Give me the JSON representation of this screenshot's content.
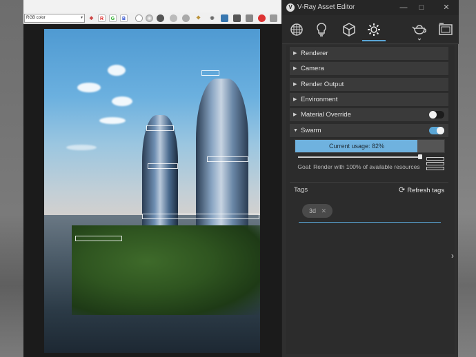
{
  "vfb": {
    "channel": "RGB color",
    "toolbar": {
      "r_label": "R",
      "g_label": "G",
      "b_label": "B"
    }
  },
  "editor": {
    "title": "V-Ray Asset Editor",
    "logo_glyph": "V",
    "window_controls": {
      "minimize": "—",
      "maximize": "□",
      "close": "✕"
    },
    "tabs": [
      {
        "name": "materials",
        "icon": "materials-sphere-icon"
      },
      {
        "name": "lights",
        "icon": "light-bulb-icon"
      },
      {
        "name": "geometry",
        "icon": "cube-icon"
      },
      {
        "name": "settings",
        "icon": "gear-icon",
        "active": true
      },
      {
        "name": "render",
        "icon": "teapot-icon"
      },
      {
        "name": "frame-buffer",
        "icon": "frame-buffer-icon"
      }
    ],
    "rollouts": [
      {
        "label": "Renderer",
        "expanded": false
      },
      {
        "label": "Camera",
        "expanded": false
      },
      {
        "label": "Render Output",
        "expanded": false
      },
      {
        "label": "Environment",
        "expanded": false
      },
      {
        "label": "Material Override",
        "expanded": false,
        "toggle": false
      },
      {
        "label": "Swarm",
        "expanded": true,
        "toggle": true
      }
    ],
    "swarm": {
      "usage_label": "Current usage: 82%",
      "usage_fraction": 0.82,
      "goal": "Goal: Render with 100% of available resources"
    },
    "tags": {
      "label": "Tags",
      "refresh_label": "Refresh tags",
      "items": [
        "3d"
      ],
      "remove_glyph": "✕"
    }
  },
  "colors": {
    "accent": "#5aa6d6",
    "panel_bg": "#2f2f2f",
    "rollout_bg": "#3a3a3a"
  }
}
